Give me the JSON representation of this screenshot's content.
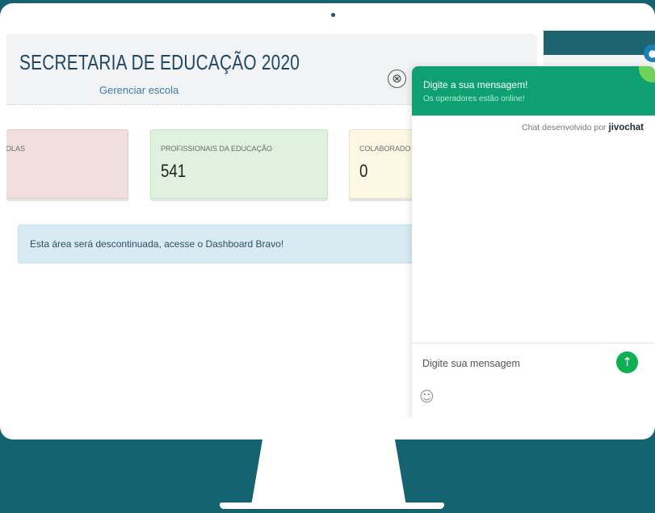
{
  "page": {
    "title": "SECRETARIA DE EDUCAÇÃO 2020",
    "manage_link": "Gerenciar escola",
    "close_icon": "⊗"
  },
  "stats": [
    {
      "label": "OLAS",
      "value": "",
      "color": "#f1dede"
    },
    {
      "label": "PROFISSIONAIS DA EDUCAÇÃO",
      "value": "541",
      "color": "#e0f1df"
    },
    {
      "label": "COLABORADO",
      "value": "0",
      "color": "#fcf8e4"
    }
  ],
  "alert": {
    "text": "Esta área será descontinuada, acesse o Dashboard Bravo!"
  },
  "chat": {
    "title": "Digite a sua mensagem!",
    "subtitle": "Os operadores estão online!",
    "powered_by": "Chat desenvolvido por",
    "brand": "jivochat",
    "input_placeholder": "Digite sua mensagem",
    "send_icon": "arrow-up-icon",
    "emoji_icon": "smiley-icon",
    "accent_color": "#0fa071",
    "send_color": "#0fb054"
  },
  "colors": {
    "background": "#156370",
    "title": "#1e4766",
    "link": "#3e7ba1"
  }
}
